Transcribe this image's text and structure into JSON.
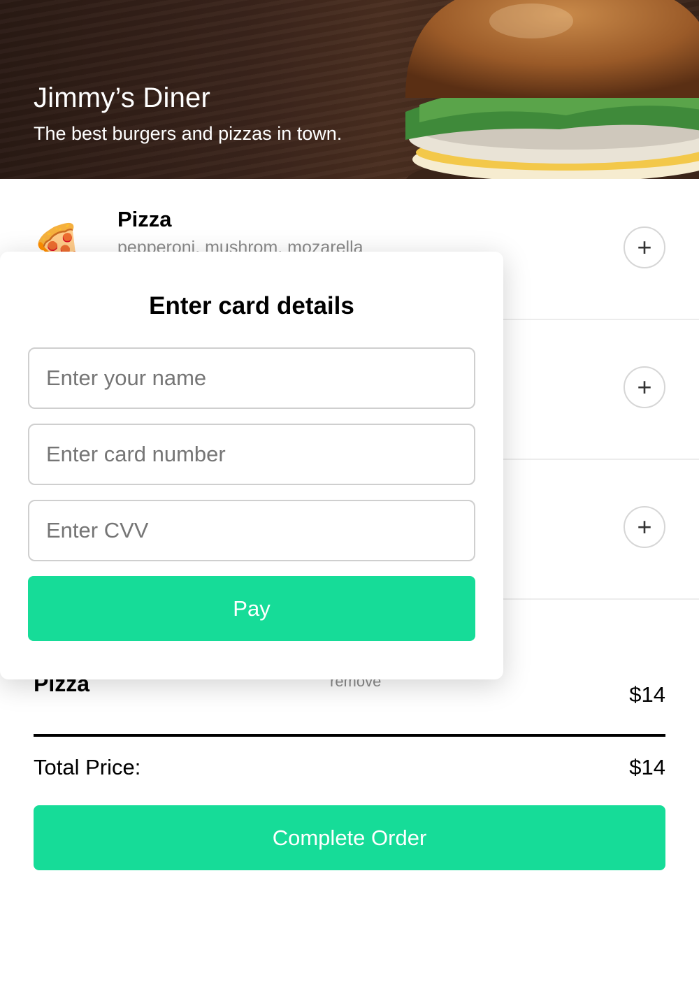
{
  "header": {
    "title": "Jimmy’s Diner",
    "subtitle": "The best burgers and pizzas in town."
  },
  "menu": {
    "items": [
      {
        "name": "Pizza",
        "description": "pepperoni, mushrom, mozarella",
        "emoji": "🍕",
        "add_label": "+"
      },
      {
        "add_label": "+"
      },
      {
        "add_label": "+"
      }
    ]
  },
  "order": {
    "items": [
      {
        "name": "Pizza",
        "remove_label": "remove",
        "price": "$14"
      }
    ],
    "total_label": "Total Price:",
    "total_price": "$14",
    "complete_label": "Complete Order"
  },
  "modal": {
    "title": "Enter card details",
    "name_placeholder": "Enter your name",
    "card_placeholder": "Enter card number",
    "cvv_placeholder": "Enter CVV",
    "pay_label": "Pay"
  },
  "colors": {
    "accent": "#16dc98",
    "header_bg": "#3a241b"
  }
}
